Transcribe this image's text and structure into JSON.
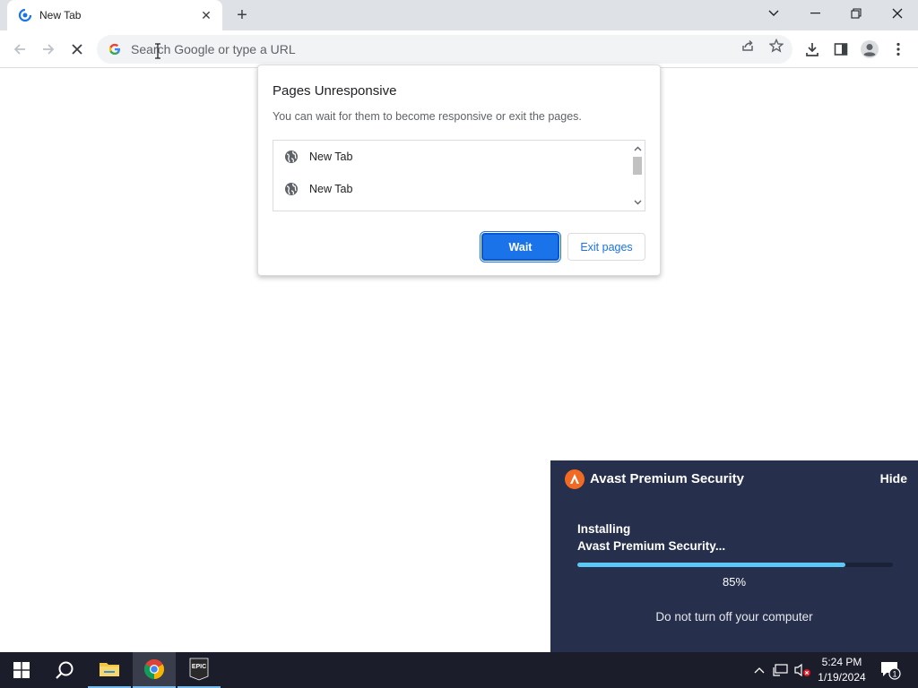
{
  "browser": {
    "tab": {
      "title": "New Tab",
      "favicon": "loading-spinner-icon",
      "close_icon": "close-icon"
    },
    "new_tab_icon": "plus-icon",
    "window_controls": [
      "tab-search-icon",
      "minimize-icon",
      "restore-icon",
      "close-icon"
    ],
    "toolbar": {
      "back_icon": "back-arrow-icon",
      "forward_icon": "forward-arrow-icon",
      "stop_icon": "stop-icon",
      "omnibox": {
        "placeholder": "Search Google or type a URL",
        "value": ""
      },
      "icons": [
        "share-icon",
        "bookmark-star-icon",
        "download-icon",
        "side-panel-icon",
        "profile-icon",
        "menu-icon"
      ]
    }
  },
  "dialog": {
    "title": "Pages Unresponsive",
    "description": "You can wait for them to become responsive or exit the pages.",
    "pages": [
      {
        "label": "New Tab",
        "icon": "globe-icon"
      },
      {
        "label": "New Tab",
        "icon": "globe-icon"
      }
    ],
    "wait_label": "Wait",
    "exit_label": "Exit pages"
  },
  "avast": {
    "title": "Avast Premium Security",
    "hide_label": "Hide",
    "status_line1": "Installing",
    "status_line2": "Avast Premium Security...",
    "progress_percent": 85,
    "progress_label": "85%",
    "warning": "Do not turn off your computer",
    "accent_color": "#f06a24",
    "progress_color": "#5cc8f5",
    "background_color": "#262f4b"
  },
  "taskbar": {
    "apps": [
      "windows-start-icon",
      "search-icon",
      "file-explorer-icon",
      "chrome-icon",
      "epic-games-icon"
    ],
    "epic_label": "EPIC",
    "tray_icons": [
      "chevron-up-icon",
      "network-icon",
      "volume-muted-icon",
      "notifications-icon"
    ],
    "time": "5:24 PM",
    "date": "1/19/2024",
    "notification_count": "1"
  }
}
